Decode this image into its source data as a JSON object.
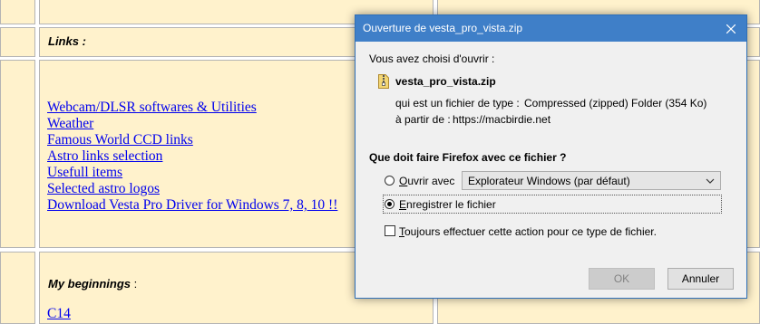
{
  "background_page": {
    "links_heading": "Links :",
    "links": [
      "Webcam/DLSR softwares & Utilities",
      "Weather",
      "Famous World CCD links",
      "Astro links selection",
      "Usefull items",
      "Selected astro logos",
      "Download Vesta Pro Driver for Windows 7, 8, 10 !!"
    ],
    "beginnings_heading": "My beginnings",
    "beginnings_colon": " :",
    "partial_link": "C14"
  },
  "dialog": {
    "title": "Ouverture de vesta_pro_vista.zip",
    "intro": "Vous avez choisi d'ouvrir :",
    "filename": "vesta_pro_vista.zip",
    "type_label": "qui est un fichier de type :",
    "type_value": "Compressed (zipped) Folder (354 Ko)",
    "from_label": "à partir de :",
    "from_value": "https://macbirdie.net",
    "question": "Que doit faire Firefox avec ce fichier ?",
    "open_with_key": "O",
    "open_with_rest": "uvrir avec",
    "open_with_app": "Explorateur Windows (par défaut)",
    "save_key": "E",
    "save_rest": "nregistrer le fichier",
    "always_key": "T",
    "always_rest": "oujours effectuer cette action pour ce type de fichier.",
    "ok_label": "OK",
    "cancel_label": "Annuler",
    "selected_option": "save"
  },
  "colors": {
    "page_cell_bg": "#fff2cc",
    "link": "#0000ee",
    "titlebar": "#3f7fc8",
    "dialog_bg": "#f0f0f0"
  },
  "icons": {
    "close": "close-icon",
    "file": "zip-file-icon",
    "dropdown": "chevron-down-icon"
  }
}
